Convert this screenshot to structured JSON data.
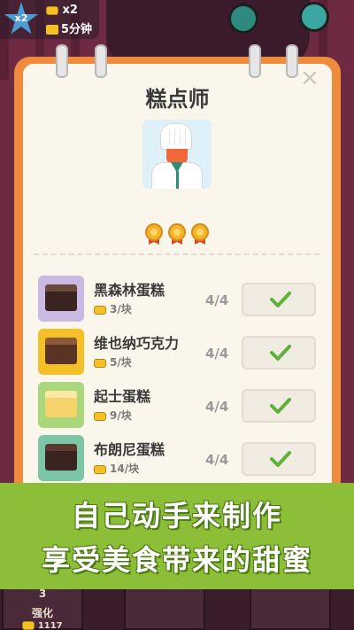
{
  "bonus": {
    "badge_text": "x2",
    "multiplier": "x2",
    "duration": "5分钟"
  },
  "modal": {
    "title": "糕点师",
    "close_symbol": "×",
    "avatar_icon": "chef-icon",
    "medals_earned": 3,
    "medal_icon": "medal-icon",
    "items": [
      {
        "name": "黑森林蛋糕",
        "price": "3/块",
        "progress": "4/4",
        "status": "completed",
        "colors": {
          "bg": "#c9b9e3",
          "cake": "#3a2420",
          "top": "#6a4a3a"
        }
      },
      {
        "name": "维也纳巧克力",
        "price": "5/块",
        "progress": "4/4",
        "status": "completed",
        "colors": {
          "bg": "#f4c025",
          "cake": "#5a3324",
          "top": "#8a5a3a"
        }
      },
      {
        "name": "起士蛋糕",
        "price": "9/块",
        "progress": "4/4",
        "status": "completed",
        "colors": {
          "bg": "#a9d77a",
          "cake": "#f6d36a",
          "top": "#fbe7a6"
        }
      },
      {
        "name": "布朗尼蛋糕",
        "price": "14/块",
        "progress": "4/4",
        "status": "completed",
        "colors": {
          "bg": "#7cc6a8",
          "cake": "#3a2420",
          "top": "#5a3a30"
        }
      }
    ]
  },
  "banner": {
    "line1": "自己动手来制作",
    "line2": "享受美食带来的甜蜜"
  },
  "background": {
    "tile_level": "3",
    "tile_label": "强化",
    "tile_value": "1117"
  }
}
